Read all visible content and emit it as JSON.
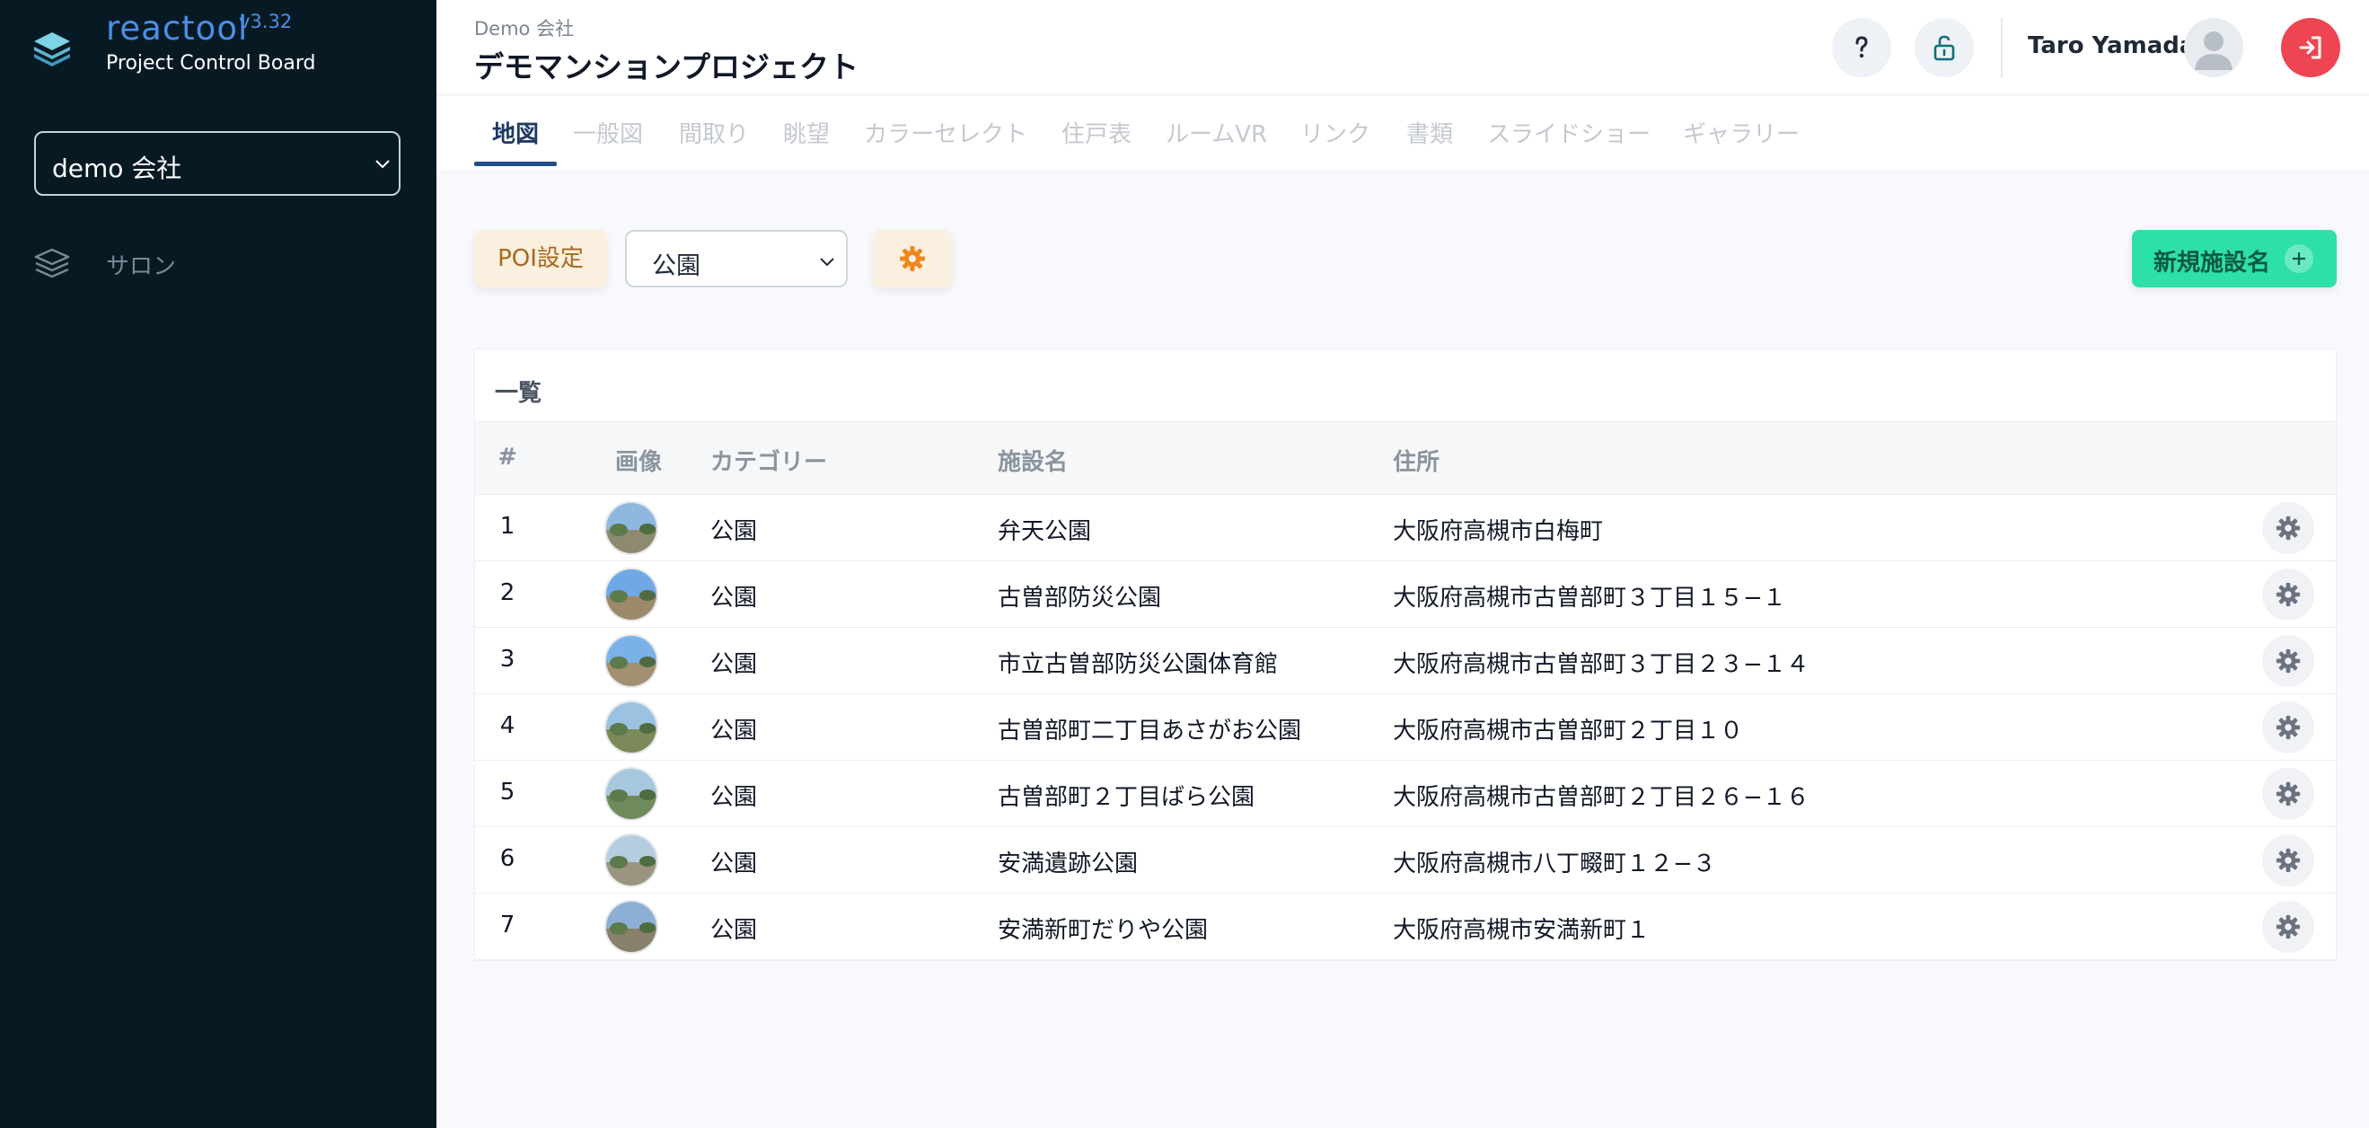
{
  "app": {
    "name": "reactool",
    "version": "v3.32",
    "subtitle": "Project Control Board"
  },
  "sidebar": {
    "company_select": {
      "value": "demo 会社"
    },
    "items": [
      {
        "label": "サロン",
        "icon": "layers-icon"
      }
    ]
  },
  "header": {
    "company": "Demo 会社",
    "project_title": "デモマンションプロジェクト",
    "user_name": "Taro Yamada"
  },
  "tabs": [
    {
      "label": "地図",
      "active": true
    },
    {
      "label": "一般図"
    },
    {
      "label": "間取り"
    },
    {
      "label": "眺望"
    },
    {
      "label": "カラーセレクト"
    },
    {
      "label": "住戸表"
    },
    {
      "label": "ルームVR"
    },
    {
      "label": "リンク"
    },
    {
      "label": "書類"
    },
    {
      "label": "スライドショー"
    },
    {
      "label": "ギャラリー"
    }
  ],
  "toolbar": {
    "poi_label": "POI設定",
    "category_select": {
      "value": "公園"
    },
    "new_button_label": "新規施設名"
  },
  "list": {
    "title": "一覧",
    "columns": [
      "#",
      "画像",
      "カテゴリー",
      "施設名",
      "住所"
    ],
    "rows": [
      {
        "no": "1",
        "category": "公園",
        "name": "弁天公園",
        "address": "大阪府高槻市白梅町"
      },
      {
        "no": "2",
        "category": "公園",
        "name": "古曽部防災公園",
        "address": "大阪府高槻市古曽部町３丁目１５−１"
      },
      {
        "no": "3",
        "category": "公園",
        "name": "市立古曽部防災公園体育館",
        "address": "大阪府高槻市古曽部町３丁目２３−１４"
      },
      {
        "no": "4",
        "category": "公園",
        "name": "古曽部町二丁目あさがお公園",
        "address": "大阪府高槻市古曽部町２丁目１０"
      },
      {
        "no": "5",
        "category": "公園",
        "name": "古曽部町２丁目ばら公園",
        "address": "大阪府高槻市古曽部町２丁目２６−１６"
      },
      {
        "no": "6",
        "category": "公園",
        "name": "安満遺跡公園",
        "address": "大阪府高槻市八丁畷町１２−３"
      },
      {
        "no": "7",
        "category": "公園",
        "name": "安満新町だりや公園",
        "address": "大阪府高槻市安満新町１"
      }
    ]
  },
  "colors": {
    "sidebar_bg": "#071a24",
    "brand_blue": "#4a8fe7",
    "tab_active": "#1f4f86",
    "new_button": "#2de0a7",
    "logout": "#ef4452",
    "poi_bg": "#fbefe0",
    "gear_orange": "#f0871a"
  }
}
